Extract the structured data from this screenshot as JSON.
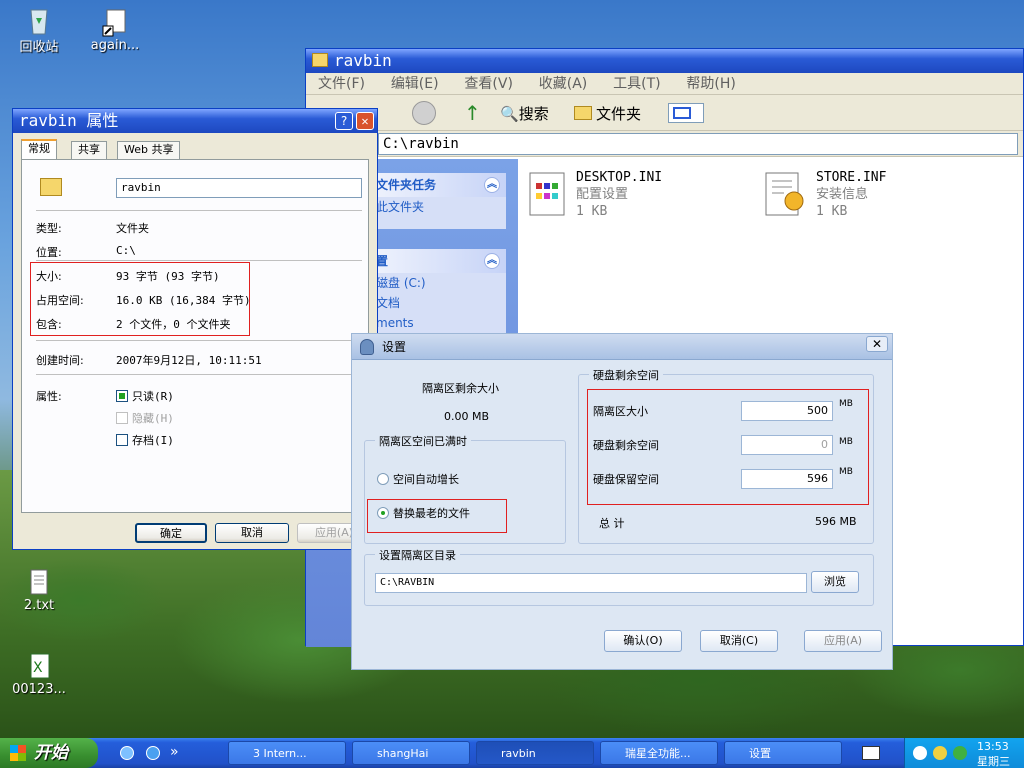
{
  "desktop": {
    "icons": [
      {
        "label": "回收站"
      },
      {
        "label": "again..."
      },
      {
        "label": "2.txt"
      },
      {
        "label": "00123..."
      }
    ]
  },
  "explorer": {
    "title": "ravbin",
    "menu": [
      "文件(F)",
      "编辑(E)",
      "查看(V)",
      "收藏(A)",
      "工具(T)",
      "帮助(H)"
    ],
    "toolbar": {
      "search": "搜索",
      "folders": "文件夹"
    },
    "address": "C:\\ravbin",
    "task_panes": [
      {
        "title": "文件夹任务",
        "links": [
          "此文件夹"
        ]
      },
      {
        "title": "置",
        "links": [
          "磁盘 (C:)",
          "文档",
          "ments"
        ]
      }
    ],
    "files": [
      {
        "name": "DESKTOP.INI",
        "type": "配置设置",
        "size": "1 KB"
      },
      {
        "name": "STORE.INF",
        "type": "安装信息",
        "size": "1 KB"
      }
    ]
  },
  "properties": {
    "title": "ravbin 属性",
    "tabs": [
      "常规",
      "共享",
      "Web 共享"
    ],
    "name_value": "ravbin",
    "rows": [
      {
        "label": "类型:",
        "value": "文件夹"
      },
      {
        "label": "位置:",
        "value": "C:\\"
      },
      {
        "label": "大小:",
        "value": "93 字节 (93 字节)"
      },
      {
        "label": "占用空间:",
        "value": "16.0 KB (16,384 字节)"
      },
      {
        "label": "包含:",
        "value": "2 个文件，0 个文件夹"
      },
      {
        "label": "创建时间:",
        "value": "2007年9月12日, 10:11:51"
      }
    ],
    "attributes_label": "属性:",
    "attributes": [
      {
        "label": "只读(R)",
        "checked": true
      },
      {
        "label": "隐藏(H)",
        "checked": false,
        "disabled": true
      },
      {
        "label": "存档(I)",
        "checked": false
      }
    ],
    "buttons": {
      "ok": "确定",
      "cancel": "取消",
      "apply": "应用(A)"
    }
  },
  "settings": {
    "title": "设置",
    "remaining_label": "隔离区剩余大小",
    "remaining_value": "0.00 MB",
    "full_group": "隔离区空间已满时",
    "options": [
      {
        "label": "空间自动增长",
        "selected": false
      },
      {
        "label": "替换最老的文件",
        "selected": true
      }
    ],
    "disk_group": "硬盘剩余空间",
    "fields": [
      {
        "label": "隔离区大小",
        "value": "500",
        "unit": "MB"
      },
      {
        "label": "硬盘剩余空间",
        "value": "0",
        "unit": "MB"
      },
      {
        "label": "硬盘保留空间",
        "value": "596",
        "unit": "MB"
      }
    ],
    "total_label": "总 计",
    "total_value": "596 MB",
    "dir_group": "设置隔离区目录",
    "dir_value": "C:\\RAVBIN",
    "browse": "浏览",
    "buttons": {
      "ok": "确认(O)",
      "cancel": "取消(C)",
      "apply": "应用(A)"
    }
  },
  "taskbar": {
    "start": "开始",
    "items": [
      {
        "label": "3 Intern..."
      },
      {
        "label": "shangHai"
      },
      {
        "label": "ravbin"
      },
      {
        "label": "瑞星全功能..."
      },
      {
        "label": "设置"
      }
    ],
    "time": "13:53",
    "day": "星期三"
  }
}
